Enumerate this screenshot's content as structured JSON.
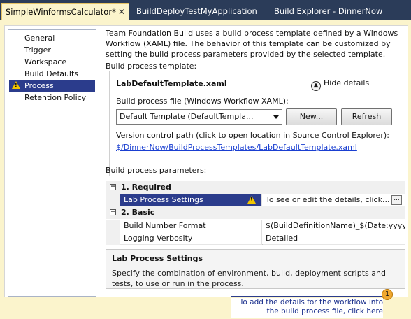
{
  "tabs": [
    {
      "label": "SimpleWinformsCalculator*",
      "active": true
    },
    {
      "label": "BuildDeployTestMyApplication",
      "active": false
    },
    {
      "label": "Build Explorer - DinnerNow",
      "active": false
    }
  ],
  "nav": {
    "items": [
      "General",
      "Trigger",
      "Workspace",
      "Build Defaults",
      "Process",
      "Retention Policy"
    ],
    "selected": "Process"
  },
  "intro": "Team Foundation Build uses a build process template defined by a Windows Workflow (XAML) file. The behavior of this template can be customized by setting the build process parameters provided by the selected template.",
  "template": {
    "group_label": "Build process template:",
    "name": "LabDefaultTemplate.xaml",
    "hide_details": "Hide details",
    "file_label": "Build process file (Windows Workflow XAML):",
    "file_value": "Default Template (DefaultTempla...",
    "new_button": "New...",
    "refresh_button": "Refresh",
    "vc_label": "Version control path (click to open location in Source Control Explorer):",
    "vc_link": "$/DinnerNow/BuildProcessTemplates/LabDefaultTemplate.xaml"
  },
  "params": {
    "label": "Build process parameters:",
    "categories": [
      {
        "name": "1. Required",
        "rows": [
          {
            "name": "Lab Process Settings",
            "value": "To see or edit the details, click...",
            "warning": true,
            "selected": true
          }
        ]
      },
      {
        "name": "2. Basic",
        "rows": [
          {
            "name": "Build Number Format",
            "value": "$(BuildDefinitionName)_$(Date:yyyy..",
            "warning": false,
            "selected": false
          },
          {
            "name": "Logging Verbosity",
            "value": "Detailed",
            "warning": false,
            "selected": false
          }
        ]
      }
    ]
  },
  "description": {
    "title": "Lab Process Settings",
    "text": "Specify the combination of environment, build, deployment scripts and tests, to use or run in the process."
  },
  "callout": {
    "number": "1",
    "text": "To add the details for the workflow into the build process file, click here"
  },
  "colors": {
    "tab_strip": "#2b3c59",
    "active_tab": "#fbf4cc",
    "selection": "#2b3c8c",
    "link": "#1a3fd1",
    "warning": "#f2c500",
    "callout_badge": "#f0a830"
  }
}
